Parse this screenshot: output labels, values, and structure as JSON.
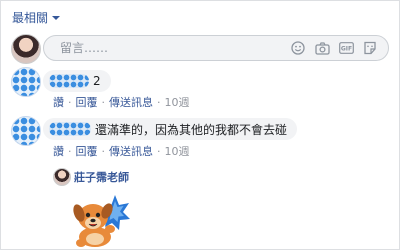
{
  "sort": {
    "label": "最相關"
  },
  "composer": {
    "placeholder": "留言……",
    "icons": [
      "emoji-icon",
      "camera-icon",
      "gif-icon",
      "sticker-icon"
    ]
  },
  "comments": [
    {
      "text": "2",
      "actions": {
        "like": "讚",
        "reply": "回覆",
        "message": "傳送訊息",
        "time": "10週"
      }
    },
    {
      "text": "還滿準的，因為其他的我都不會去碰",
      "actions": {
        "like": "讚",
        "reply": "回覆",
        "message": "傳送訊息",
        "time": "10週"
      }
    }
  ],
  "reply": {
    "author": "莊子霈老師",
    "sticker": "dog-sticker"
  },
  "colors": {
    "link": "#385898",
    "bubble": "#f2f3f5",
    "meta": "#90949c",
    "border": "#dddfe2"
  }
}
